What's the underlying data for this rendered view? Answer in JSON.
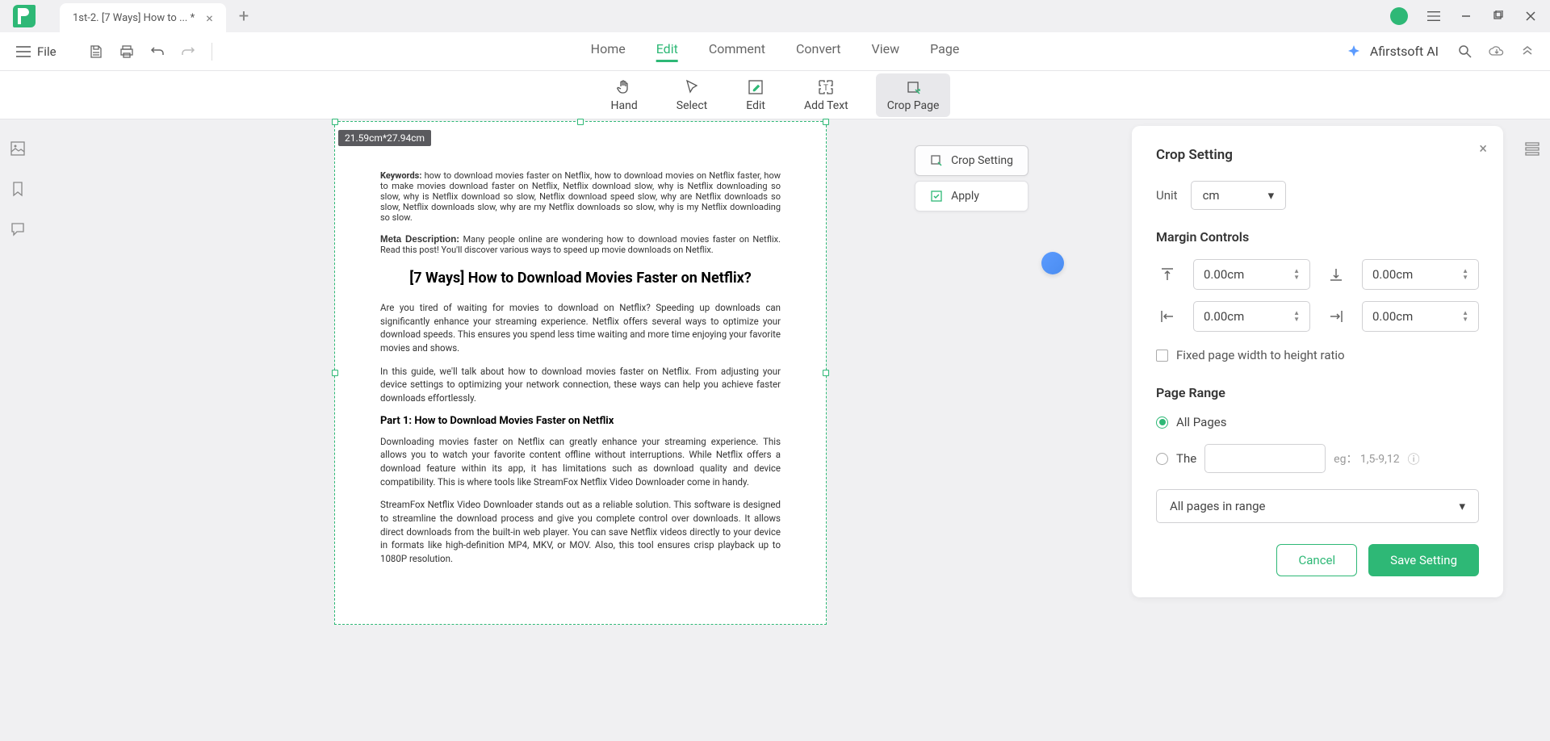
{
  "titlebar": {
    "tab_title": "1st-2. [7 Ways] How to ... *"
  },
  "menubar": {
    "file": "File",
    "nav": {
      "home": "Home",
      "edit": "Edit",
      "comment": "Comment",
      "convert": "Convert",
      "view": "View",
      "page": "Page"
    },
    "ai_label": "Afirstsoft AI"
  },
  "toolbar": {
    "hand": "Hand",
    "select": "Select",
    "edit": "Edit",
    "add_text": "Add Text",
    "crop_page": "Crop Page"
  },
  "canvas": {
    "dimensions": "21.59cm*27.94cm"
  },
  "context": {
    "crop_setting": "Crop Setting",
    "apply": "Apply"
  },
  "document": {
    "keywords_label": "Keywords:",
    "keywords_text": " how to download movies faster on Netflix, how to download movies on Netflix faster, how to make movies download faster on Netflix, Netflix download slow, why is Netflix downloading so slow, why is Netflix download so slow, Netflix download speed slow, why are Netflix downloads so slow, Netflix downloads slow, why are my Netflix downloads so slow, why is my Netflix downloading so slow.",
    "meta_label": "Meta Description:",
    "meta_text": " Many people online are wondering how to download movies faster on Netflix. Read this post! You'll discover various ways to speed up movie downloads on Netflix.",
    "title": "[7 Ways] How to Download Movies Faster on Netflix?",
    "p1": "Are you tired of waiting for movies to download on Netflix? Speeding up downloads can significantly enhance your streaming experience. Netflix offers several ways to optimize your download speeds. This ensures you spend less time waiting and more time enjoying your favorite movies and shows.",
    "p2": "In this guide, we'll talk about how to download movies faster on Netflix. From adjusting your device settings to optimizing your network connection, these ways can help you achieve faster downloads effortlessly.",
    "h3": "Part 1: How to Download Movies Faster on Netflix",
    "p3": "Downloading movies faster on Netflix can greatly enhance your streaming experience. This allows you to watch your favorite content offline without interruptions. While Netflix offers a download feature within its app, it has limitations such as download quality and device compatibility. This is where tools like StreamFox Netflix Video Downloader come in handy.",
    "p4": "StreamFox Netflix Video Downloader stands out as a reliable solution. This software is designed to streamline the download process and give you complete control over downloads. It allows direct downloads from the built-in web player. You can save Netflix videos directly to your device in formats like high-definition MP4, MKV, or MOV. Also, this tool ensures crisp playback up to 1080P resolution."
  },
  "panel": {
    "title": "Crop Setting",
    "unit_label": "Unit",
    "unit_value": "cm",
    "margin_title": "Margin Controls",
    "margin_top": "0.00cm",
    "margin_bottom": "0.00cm",
    "margin_left": "0.00cm",
    "margin_right": "0.00cm",
    "fixed_ratio": "Fixed page width to height ratio",
    "page_range_title": "Page Range",
    "all_pages": "All Pages",
    "the_label": "The",
    "eg_text": "eg： 1,5-9,12",
    "range_select": "All pages in range",
    "cancel": "Cancel",
    "save": "Save Setting"
  }
}
